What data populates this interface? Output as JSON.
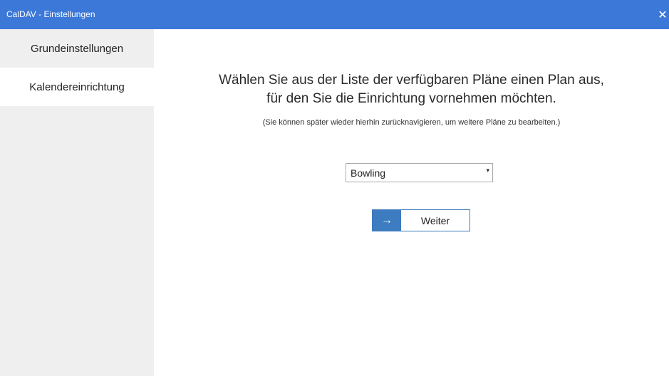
{
  "window": {
    "title": "CalDAV - Einstellungen",
    "close_glyph": "✕"
  },
  "sidebar": {
    "items": [
      {
        "label": "Grundeinstellungen",
        "active": false
      },
      {
        "label": "Kalendereinrichtung",
        "active": true
      }
    ]
  },
  "main": {
    "heading_line1": "Wählen Sie aus der Liste der verfügbaren Pläne einen Plan aus,",
    "heading_line2": "für den Sie die Einrichtung vornehmen möchten.",
    "hint": "(Sie können später wieder hierhin zurücknavigieren, um weitere Pläne zu bearbeiten.)",
    "plan_select": {
      "value": "Bowling",
      "caret_glyph": "▾"
    },
    "next_button": {
      "label": "Weiter",
      "arrow_glyph": "→"
    }
  },
  "colors": {
    "titlebar": "#3b78d8",
    "sidebar": "#efefef",
    "accent": "#3d7cc0"
  }
}
